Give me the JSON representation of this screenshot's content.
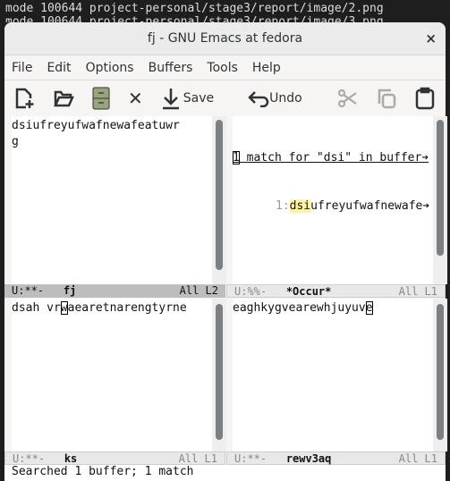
{
  "terminal": {
    "line1": "mode 100644 project-personal/stage3/report/image/2.png",
    "line2": "mode 100644 project-personal/stage3/report/image/3.png"
  },
  "window": {
    "title": "fj - GNU Emacs at fedora",
    "close": "×"
  },
  "menu": [
    "File",
    "Edit",
    "Options",
    "Buffers",
    "Tools",
    "Help"
  ],
  "toolbar": {
    "save": "Save",
    "undo": "Undo"
  },
  "panes": {
    "top_left": {
      "line1": "dsiufreyufwafnewafeatuwr",
      "line2": "g",
      "modeline": {
        "status": "U:**-",
        "name": "fj",
        "pos": "All L2"
      }
    },
    "top_right": {
      "header_cursor": "1",
      "header_rest": " match for \"dsi\" in buffer",
      "linenum": "1:",
      "match": "dsi",
      "rest": "ufreyufwafnewafe",
      "trunc": "➔",
      "modeline": {
        "status": "U:%%-",
        "name": "*Occur*",
        "pos": "All L1"
      }
    },
    "bottom_left": {
      "pre": "dsah vr",
      "cursor": "w",
      "post": "aearetnarengtyrne",
      "modeline": {
        "status": "U:**-",
        "name": "ks",
        "pos": "All L1"
      }
    },
    "bottom_right": {
      "pre": "eaghkygvearewhjuyuv",
      "cursor": "e",
      "modeline": {
        "status": "U:**-",
        "name": "rewv3aq",
        "pos": "All L1"
      }
    }
  },
  "echo": "Searched 1 buffer; 1 match"
}
